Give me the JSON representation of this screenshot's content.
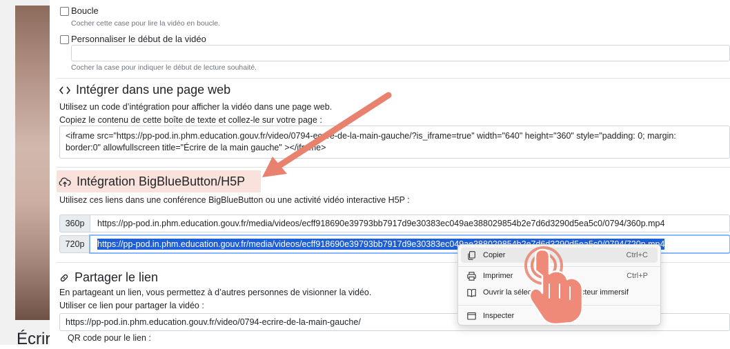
{
  "video": {
    "title": "Écrir"
  },
  "options": {
    "loop": {
      "label": "Boucle",
      "help": "Cocher cette case pour lire la vidéo en boucle."
    },
    "start": {
      "label": "Personnaliser le début de la vidéo",
      "value": "",
      "help": "Cocher la case pour indiquer le début de lecture souhaité."
    }
  },
  "embed": {
    "heading": "Intégrer dans une page web",
    "desc": "Utilisez un code d’intégration pour afficher la vidéo dans une page web.",
    "instruction": "Copiez le contenu de cette boîte de texte et collez-le sur votre page :",
    "code_line1": "<iframe src=\"https://pp-pod.in.phm.education.gouv.fr/video/0794-ecrire-de-la-main-gauche/?is_iframe=true\" width=\"640\" height=\"360\" style=\"padding: 0; margin:",
    "code_line2": "border:0\" allowfullscreen title=\"Écrire de la main gauche\" ></iframe>"
  },
  "bbb": {
    "heading": "Intégration BigBlueButton/H5P",
    "desc": "Utilisez ces liens dans une conférence BigBlueButton ou une activité vidéo interactive H5P :",
    "links": [
      {
        "quality": "360p",
        "url": "https://pp-pod.in.phm.education.gouv.fr/media/videos/ecff918690e39793bb7917d9e30383ec049ae388029854b2e7d6d3290d5ea5c0/0794/360p.mp4"
      },
      {
        "quality": "720p",
        "url": "https://pp-pod.in.phm.education.gouv.fr/media/videos/ecff918690e39793bb7917d9e30383ec049ae388029854b2e7d6d3290d5ea5c0/0794/720p.mp4"
      }
    ]
  },
  "share": {
    "heading": "Partager le lien",
    "desc": "En partageant un lien, vous permettez à d’autres personnes de visionner la vidéo.",
    "use_label": "Utiliser ce lien pour partager la vidéo :",
    "url": "https://pp-pod.in.phm.education.gouv.fr/video/0794-ecrire-de-la-main-gauche/",
    "qr_label": "QR code pour le lien :"
  },
  "context_menu": {
    "items": [
      {
        "label": "Copier",
        "shortcut": "Ctrl+C",
        "icon": "copy-icon"
      },
      {
        "label": "Imprimer",
        "shortcut": "Ctrl+P",
        "icon": "print-icon"
      },
      {
        "label": "Ouvrir la sélection dans le Lecteur immersif",
        "shortcut": "",
        "icon": "immersive-reader-icon"
      },
      {
        "label": "Inspecter",
        "shortcut": "",
        "icon": "inspect-icon"
      }
    ]
  },
  "annotation": {
    "arrow_color": "#e8826f",
    "hand_color": "#f08a78",
    "highlight_color": "#f9e1dc"
  }
}
